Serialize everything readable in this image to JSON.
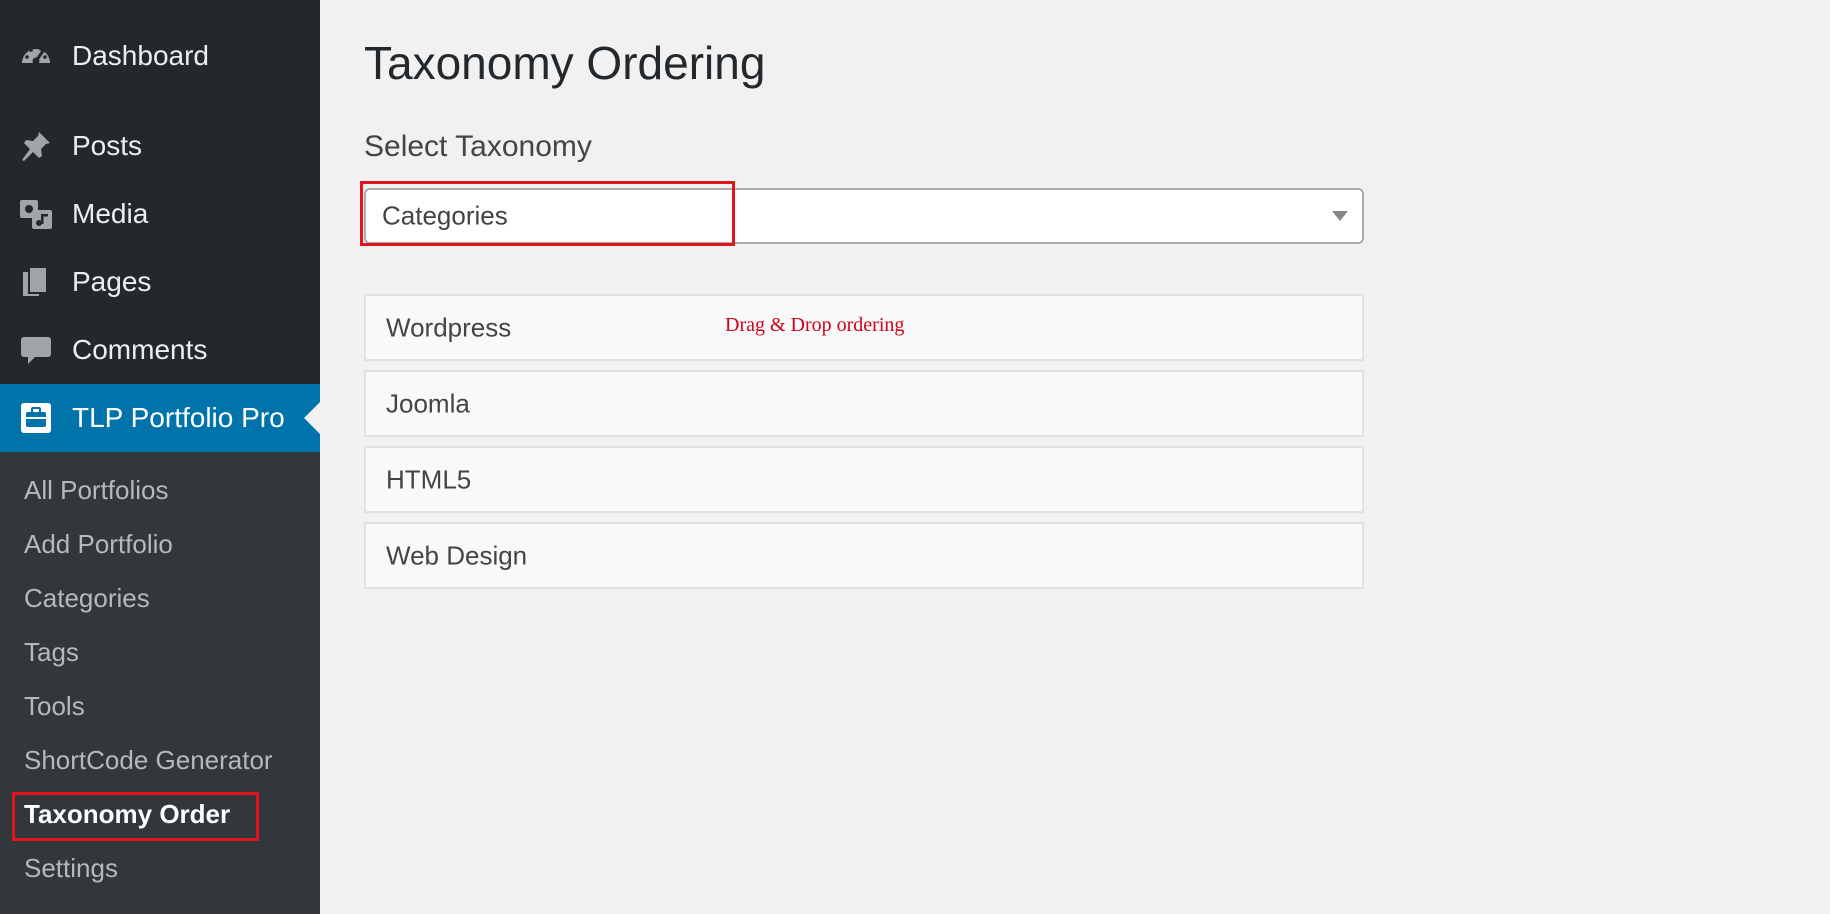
{
  "sidebar": {
    "menu": [
      {
        "label": "Dashboard",
        "icon": "dashboard-icon"
      },
      {
        "label": "Posts",
        "icon": "pin-icon"
      },
      {
        "label": "Media",
        "icon": "media-icon"
      },
      {
        "label": "Pages",
        "icon": "pages-icon"
      },
      {
        "label": "Comments",
        "icon": "comment-icon"
      },
      {
        "label": "TLP Portfolio Pro",
        "icon": "portfolio-icon",
        "active": true
      }
    ],
    "submenu": [
      {
        "label": "All Portfolios"
      },
      {
        "label": "Add Portfolio"
      },
      {
        "label": "Categories"
      },
      {
        "label": "Tags"
      },
      {
        "label": "Tools"
      },
      {
        "label": "ShortCode Generator"
      },
      {
        "label": "Taxonomy Order",
        "current": true
      },
      {
        "label": "Settings"
      }
    ]
  },
  "main": {
    "title": "Taxonomy Ordering",
    "select_label": "Select Taxonomy",
    "select_value": "Categories",
    "items": [
      {
        "label": "Wordpress"
      },
      {
        "label": "Joomla"
      },
      {
        "label": "HTML5"
      },
      {
        "label": "Web Design"
      }
    ],
    "annotation": "Drag & Drop ordering"
  },
  "colors": {
    "sidebar_bg": "#23282d",
    "submenu_bg": "#32373c",
    "active_bg": "#0073aa",
    "highlight": "#e2141c",
    "annotation": "#d0021b"
  }
}
